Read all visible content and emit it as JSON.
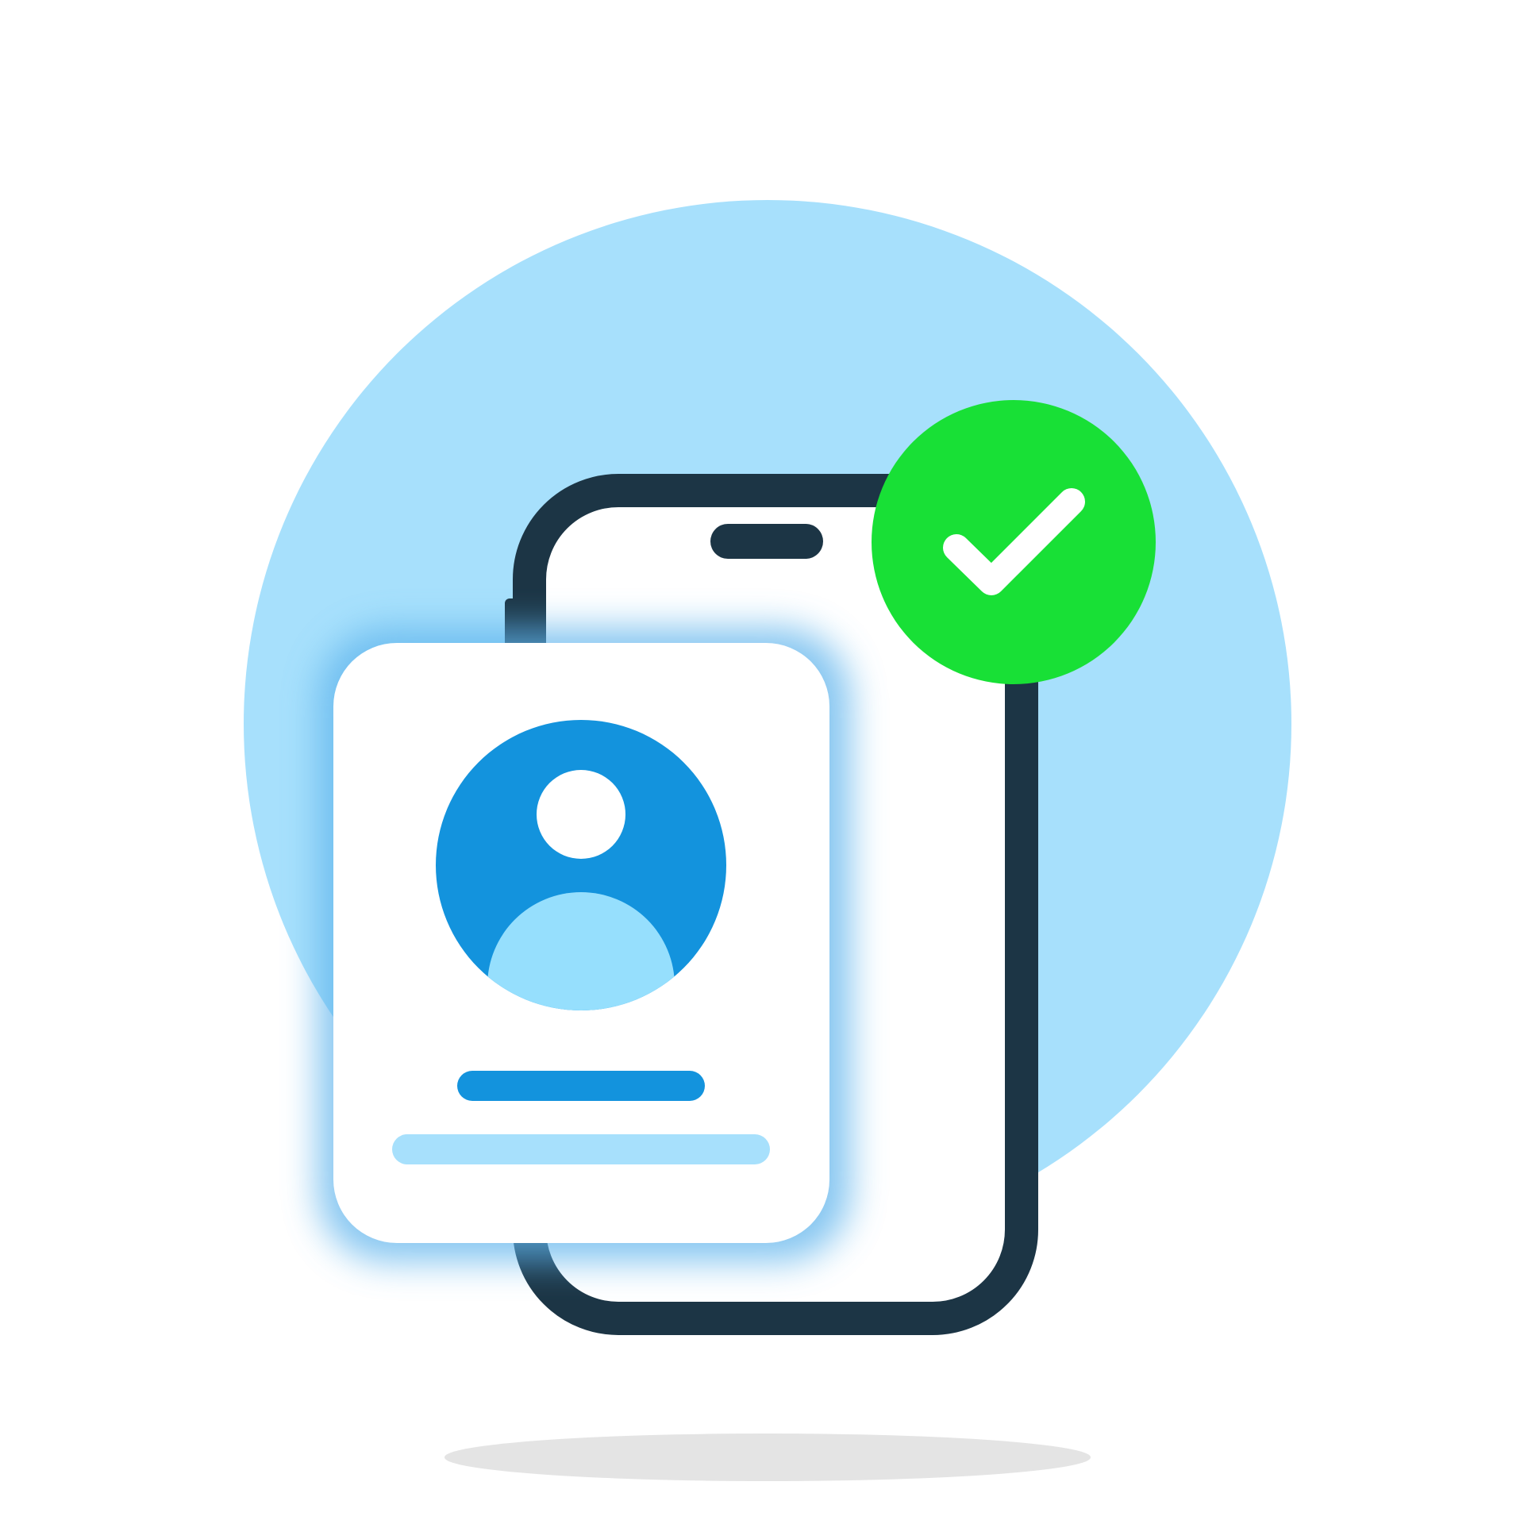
{
  "illustration": {
    "subject": "verified-user-profile",
    "icons": [
      "smartphone-icon",
      "profile-card-icon",
      "user-avatar-icon",
      "check-mark-icon"
    ],
    "colors": {
      "background": "#ffffff",
      "backdrop_circle": "#a7e0fc",
      "phone_outline": "#1c3545",
      "phone_screen": "#ffffff",
      "card_background": "#ffffff",
      "card_glow": "#5fb4ec",
      "avatar_circle": "#1393dd",
      "avatar_head": "#ffffff",
      "avatar_body": "#96dffd",
      "name_bar": "#1393dd",
      "detail_bar": "#a7e0fc",
      "badge": "#18e036",
      "check_mark": "#ffffff",
      "floor_shadow": "#e4e4e4"
    }
  }
}
